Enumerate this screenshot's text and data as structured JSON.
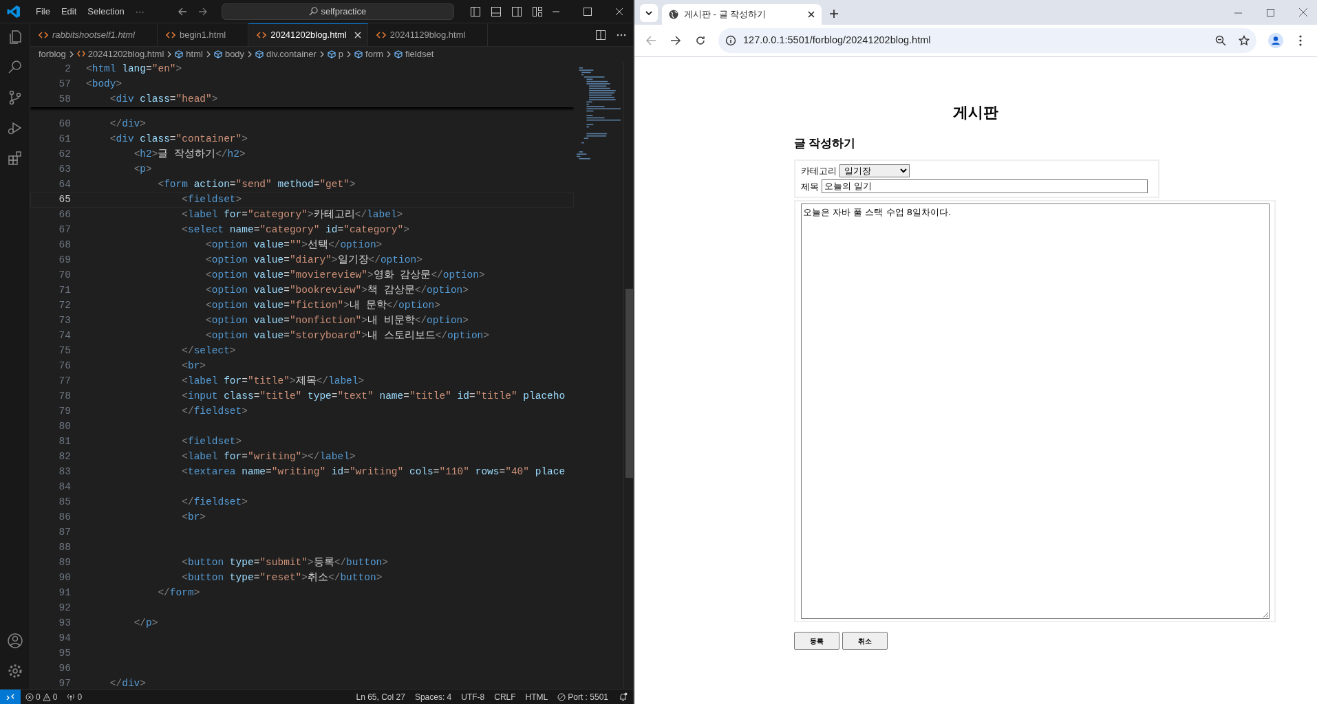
{
  "vscode": {
    "menu": [
      "File",
      "Edit",
      "Selection",
      "···"
    ],
    "search": "selfpractice",
    "tabs": [
      {
        "label": "rabbitshootself1.html",
        "selected": false,
        "preview": true
      },
      {
        "label": "begin1.html",
        "selected": false,
        "preview": false
      },
      {
        "label": "20241202blog.html",
        "selected": true,
        "preview": false
      },
      {
        "label": "20241129blog.html",
        "selected": false,
        "preview": false
      }
    ],
    "breadcrumbs": [
      {
        "label": "forblog",
        "kind": "folder"
      },
      {
        "label": "20241202blog.html",
        "kind": "file"
      },
      {
        "label": "html",
        "kind": "element"
      },
      {
        "label": "body",
        "kind": "element"
      },
      {
        "label": "div.container",
        "kind": "element"
      },
      {
        "label": "p",
        "kind": "element"
      },
      {
        "label": "form",
        "kind": "element"
      },
      {
        "label": "fieldset",
        "kind": "element"
      }
    ],
    "sticky_lines": [
      {
        "number": "2",
        "text": "<html lang=\"en\">"
      },
      {
        "number": "57",
        "text": "<body>"
      },
      {
        "number": "58",
        "text": "    <div class=\"head\">"
      }
    ],
    "code_lines": [
      {
        "number": "60",
        "text": "    </div>",
        "current": false
      },
      {
        "number": "61",
        "text": "    <div class=\"container\">",
        "current": false
      },
      {
        "number": "62",
        "text": "        <h2>글 작성하기</h2>",
        "current": false
      },
      {
        "number": "63",
        "text": "        <p>",
        "current": false
      },
      {
        "number": "64",
        "text": "            <form action=\"send\" method=\"get\">",
        "current": false
      },
      {
        "number": "65",
        "text": "                <fieldset>",
        "current": true
      },
      {
        "number": "66",
        "text": "                <label for=\"category\">카테고리</label>",
        "current": false
      },
      {
        "number": "67",
        "text": "                <select name=\"category\" id=\"category\">",
        "current": false
      },
      {
        "number": "68",
        "text": "                    <option value=\"\">선택</option>",
        "current": false
      },
      {
        "number": "69",
        "text": "                    <option value=\"diary\">일기장</option>",
        "current": false
      },
      {
        "number": "70",
        "text": "                    <option value=\"moviereview\">영화 감상문</option>",
        "current": false
      },
      {
        "number": "71",
        "text": "                    <option value=\"bookreview\">책 감상문</option>",
        "current": false
      },
      {
        "number": "72",
        "text": "                    <option value=\"fiction\">내 문학</option>",
        "current": false
      },
      {
        "number": "73",
        "text": "                    <option value=\"nonfiction\">내 비문학</option>",
        "current": false
      },
      {
        "number": "74",
        "text": "                    <option value=\"storyboard\">내 스토리보드</option>",
        "current": false
      },
      {
        "number": "75",
        "text": "                </select>",
        "current": false
      },
      {
        "number": "76",
        "text": "                <br>",
        "current": false
      },
      {
        "number": "77",
        "text": "                <label for=\"title\">제목</label>",
        "current": false
      },
      {
        "number": "78",
        "text": "                <input class=\"title\" type=\"text\" name=\"title\" id=\"title\" placeho",
        "current": false
      },
      {
        "number": "79",
        "text": "                </fieldset>",
        "current": false
      },
      {
        "number": "80",
        "current": false
      },
      {
        "number": "81",
        "text": "                <fieldset>",
        "current": false
      },
      {
        "number": "82",
        "text": "                <label for=\"writing\"></label>",
        "current": false
      },
      {
        "number": "83",
        "text": "                <textarea name=\"writing\" id=\"writing\" cols=\"110\" rows=\"40\" place",
        "current": false
      },
      {
        "number": "84",
        "current": false
      },
      {
        "number": "85",
        "text": "                </fieldset>",
        "current": false
      },
      {
        "number": "86",
        "text": "                <br>",
        "current": false
      },
      {
        "number": "87",
        "current": false
      },
      {
        "number": "88",
        "current": false
      },
      {
        "number": "89",
        "text": "                <button type=\"submit\">등록</button>",
        "current": false
      },
      {
        "number": "90",
        "text": "                <button type=\"reset\">취소</button>",
        "current": false
      },
      {
        "number": "91",
        "text": "            </form>",
        "current": false
      },
      {
        "number": "92",
        "current": false
      },
      {
        "number": "93",
        "text": "        </p>",
        "current": false
      },
      {
        "number": "94",
        "current": false
      },
      {
        "number": "95",
        "current": false
      },
      {
        "number": "96",
        "current": false
      },
      {
        "number": "97",
        "text": "    </div>",
        "current": false
      }
    ],
    "status_bar": {
      "errors": "0",
      "warnings": "0",
      "ports": "0",
      "position": "Ln 65, Col 27",
      "spaces": "Spaces: 4",
      "encoding": "UTF-8",
      "eol": "CRLF",
      "language": "HTML",
      "port": "Port : 5501"
    }
  },
  "browser": {
    "tabs": [
      {
        "label": "게시판 - 글 작성하기",
        "selected": true
      }
    ],
    "url": "127.0.0.1:5501/forblog/20241202blog.html",
    "page": {
      "heading": "게시판",
      "subheading": "글 작성하기",
      "category_label": "카테고리",
      "category_value": "일기장",
      "title_label": "제목",
      "title_value": "오늘의 일기",
      "body_text": "오늘은 자바 풀 스택 수업 8일차이다.",
      "buttons": [
        "등록",
        "취소"
      ]
    }
  }
}
